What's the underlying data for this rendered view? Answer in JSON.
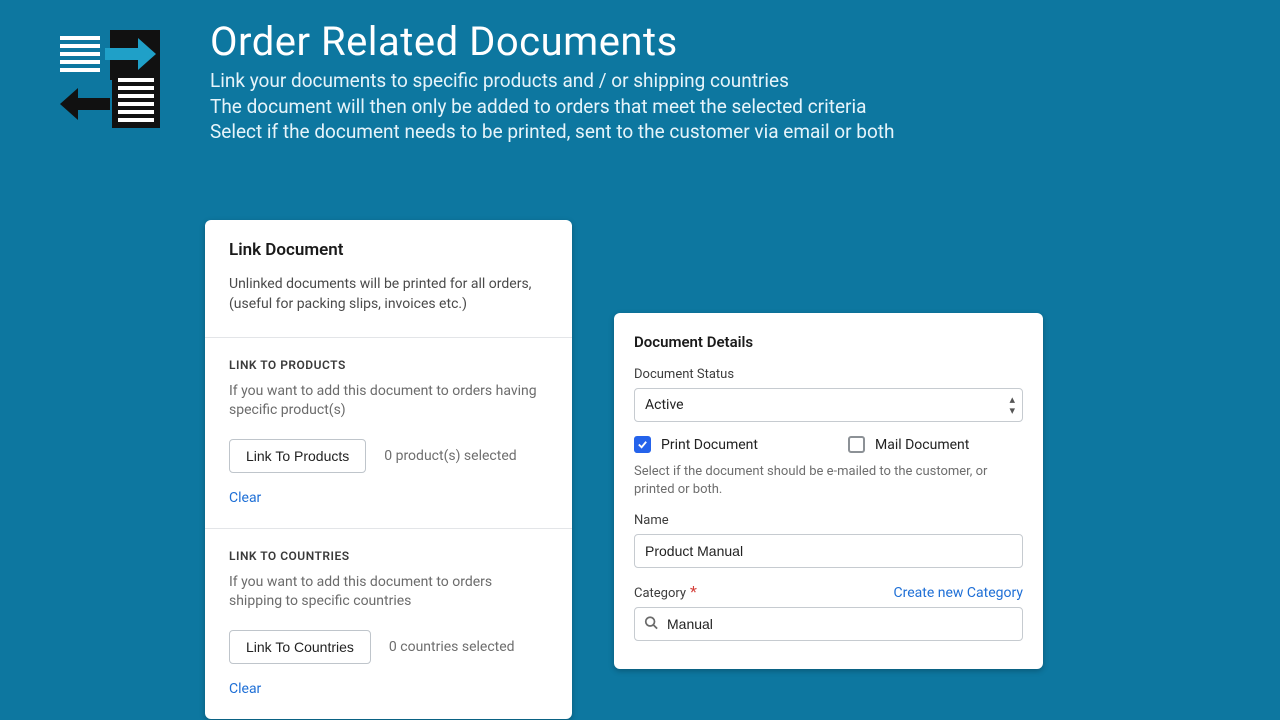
{
  "header": {
    "title": "Order Related Documents",
    "line1": "Link your documents to specific products and / or shipping countries",
    "line2": "The document will then only be added to orders that meet the selected criteria",
    "line3": "Select if the document needs to be printed, sent to the customer via email or both"
  },
  "link_card": {
    "title": "Link Document",
    "intro": "Unlinked documents will be printed for all orders, (useful for packing slips, invoices etc.)",
    "products": {
      "header": "LINK TO PRODUCTS",
      "desc": "If you want to add this document to orders having specific product(s)",
      "button": "Link To Products",
      "status": "0 product(s) selected",
      "clear": "Clear"
    },
    "countries": {
      "header": "LINK TO COUNTRIES",
      "desc": "If you want to add this document to orders shipping to specific countries",
      "button": "Link To Countries",
      "status": "0 countries selected",
      "clear": "Clear"
    }
  },
  "details": {
    "title": "Document Details",
    "status_label": "Document Status",
    "status_value": "Active",
    "print_label": "Print Document",
    "mail_label": "Mail Document",
    "help": "Select if the document should be e-mailed to the customer, or printed or both.",
    "name_label": "Name",
    "name_value": "Product Manual",
    "category_label": "Category",
    "create_category": "Create new Category",
    "category_value": "Manual"
  }
}
